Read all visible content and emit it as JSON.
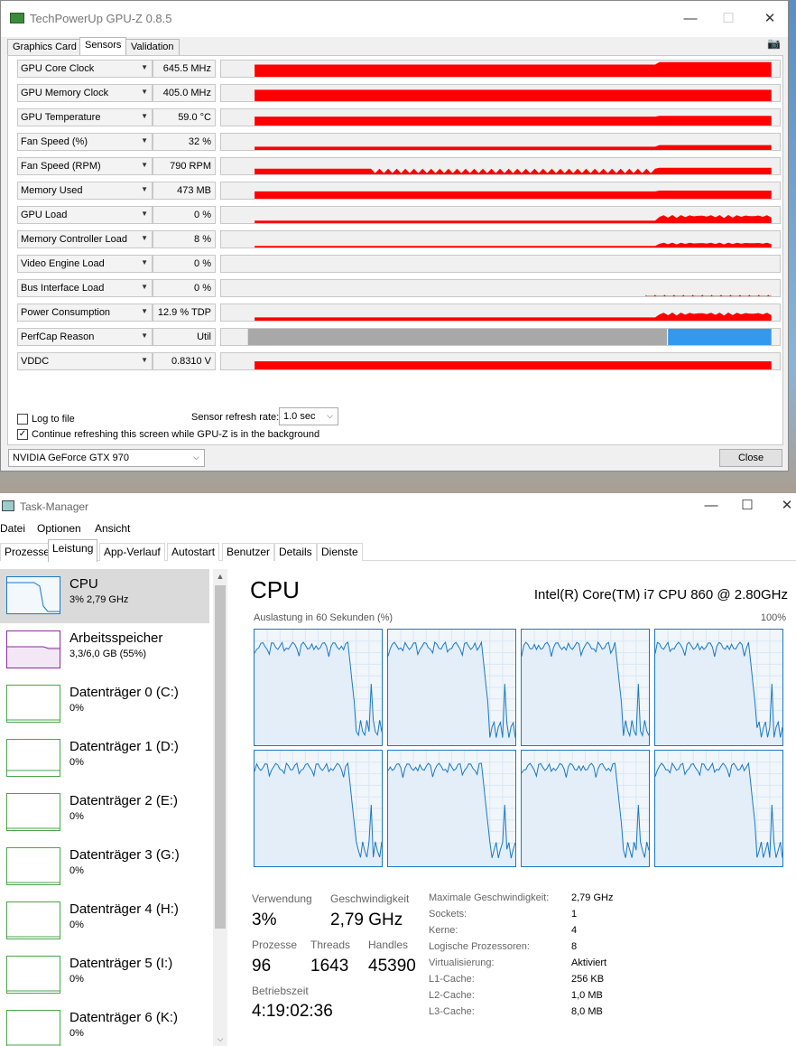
{
  "gpuz": {
    "title": "TechPowerUp GPU-Z 0.8.5",
    "tabs": [
      "Graphics Card",
      "Sensors",
      "Validation"
    ],
    "active_tab": "Sensors",
    "sensors": [
      {
        "name": "GPU Core Clock",
        "value": "645.5 MHz"
      },
      {
        "name": "GPU Memory Clock",
        "value": "405.0 MHz"
      },
      {
        "name": "GPU Temperature",
        "value": "59.0 °C"
      },
      {
        "name": "Fan Speed (%)",
        "value": "32 %"
      },
      {
        "name": "Fan Speed (RPM)",
        "value": "790 RPM"
      },
      {
        "name": "Memory Used",
        "value": "473 MB"
      },
      {
        "name": "GPU Load",
        "value": "0 %"
      },
      {
        "name": "Memory Controller Load",
        "value": "8 %"
      },
      {
        "name": "Video Engine Load",
        "value": "0 %"
      },
      {
        "name": "Bus Interface Load",
        "value": "0 %"
      },
      {
        "name": "Power Consumption",
        "value": "12.9 % TDP"
      },
      {
        "name": "PerfCap Reason",
        "value": "Util"
      },
      {
        "name": "VDDC",
        "value": "0.8310 V"
      }
    ],
    "log_to_file_label": "Log to file",
    "log_to_file_checked": false,
    "continue_refresh_label": "Continue refreshing this screen while GPU-Z is in the background",
    "continue_refresh_checked": true,
    "refresh_rate_label": "Sensor refresh rate:",
    "refresh_rate_value": "1.0 sec",
    "gpu_select": "NVIDIA GeForce GTX 970",
    "close_label": "Close",
    "graph_color": "#ff0000",
    "perfcap_idle_color": "#a8a8a8",
    "perfcap_util_color": "#3399ee"
  },
  "taskmgr": {
    "title": "Task-Manager",
    "menu": [
      "Datei",
      "Optionen",
      "Ansicht"
    ],
    "tabs": [
      "Prozesse",
      "Leistung",
      "App-Verlauf",
      "Autostart",
      "Benutzer",
      "Details",
      "Dienste"
    ],
    "active_tab": "Leistung",
    "sidebar": [
      {
        "title": "CPU",
        "sub": "3% 2,79 GHz",
        "kind": "cpu"
      },
      {
        "title": "Arbeitsspeicher",
        "sub": "3,3/6,0 GB (55%)",
        "kind": "mem"
      },
      {
        "title": "Datenträger 0 (C:)",
        "sub": "0%",
        "kind": "disk"
      },
      {
        "title": "Datenträger 1 (D:)",
        "sub": "0%",
        "kind": "disk"
      },
      {
        "title": "Datenträger 2 (E:)",
        "sub": "0%",
        "kind": "disk"
      },
      {
        "title": "Datenträger 3 (G:)",
        "sub": "0%",
        "kind": "disk"
      },
      {
        "title": "Datenträger 4 (H:)",
        "sub": "0%",
        "kind": "disk"
      },
      {
        "title": "Datenträger 5 (I:)",
        "sub": "0%",
        "kind": "disk"
      },
      {
        "title": "Datenträger 6 (K:)",
        "sub": "0%",
        "kind": "disk"
      }
    ],
    "main": {
      "title": "CPU",
      "model": "Intel(R) Core(TM) i7 CPU 860 @ 2.80GHz",
      "util_label": "Auslastung in 60 Sekunden (%)",
      "util_max": "100%",
      "stats": {
        "verwendung_label": "Verwendung",
        "verwendung": "3%",
        "geschwindigkeit_label": "Geschwindigkeit",
        "geschwindigkeit": "2,79 GHz",
        "prozesse_label": "Prozesse",
        "prozesse": "96",
        "threads_label": "Threads",
        "threads": "1643",
        "handles_label": "Handles",
        "handles": "45390",
        "betriebszeit_label": "Betriebszeit",
        "betriebszeit": "4:19:02:36"
      },
      "specs": [
        {
          "k": "Maximale Geschwindigkeit:",
          "v": "2,79 GHz"
        },
        {
          "k": "Sockets:",
          "v": "1"
        },
        {
          "k": "Kerne:",
          "v": "4"
        },
        {
          "k": "Logische Prozessoren:",
          "v": "8"
        },
        {
          "k": "Virtualisierung:",
          "v": "Aktiviert"
        },
        {
          "k": "L1-Cache:",
          "v": "256 KB"
        },
        {
          "k": "L2-Cache:",
          "v": "1,0 MB"
        },
        {
          "k": "L3-Cache:",
          "v": "8,0 MB"
        }
      ]
    },
    "cpu_line_color": "#1a78c6",
    "mem_line_color": "#8a2da0",
    "disk_line_color": "#4aa64a"
  }
}
